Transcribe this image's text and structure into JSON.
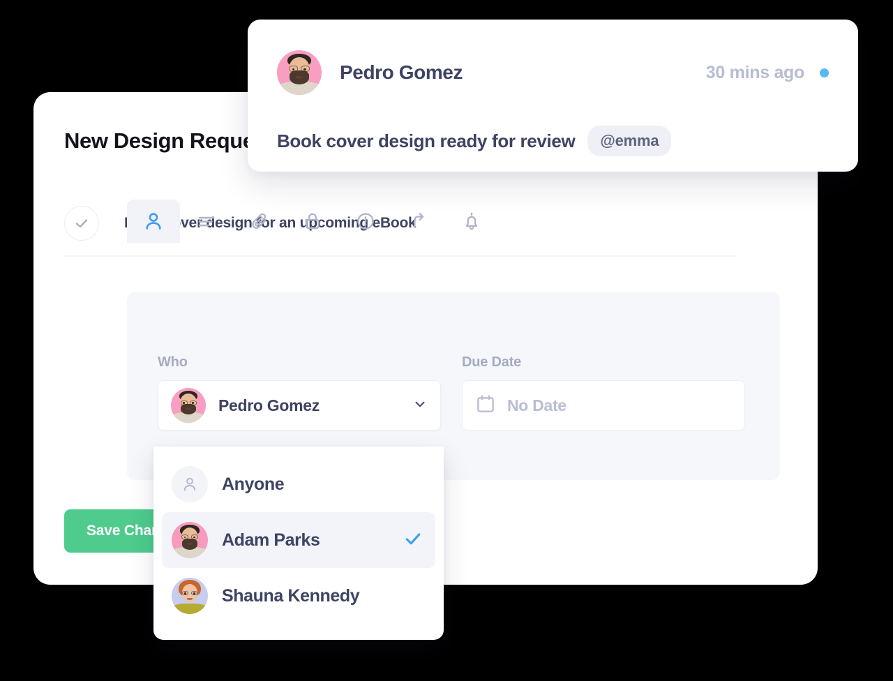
{
  "main_card": {
    "title": "New Design Request",
    "task": {
      "label": "Book cover design for an upcoming eBook",
      "status_icon": "check-circle-icon",
      "completed": false
    },
    "tabs": [
      {
        "id": "who",
        "icon": "person-icon",
        "active": true
      },
      {
        "id": "description",
        "icon": "lines-icon",
        "active": false
      },
      {
        "id": "attachments",
        "icon": "paperclip-icon",
        "active": false
      },
      {
        "id": "privacy",
        "icon": "lock-icon",
        "active": false
      },
      {
        "id": "priority",
        "icon": "exclamation-circle-icon",
        "active": false
      },
      {
        "id": "escalate",
        "icon": "arrow-up-icon",
        "active": false
      },
      {
        "id": "reminders",
        "icon": "bell-icon",
        "active": false
      }
    ],
    "fields": {
      "who": {
        "label": "Who",
        "value": "Pedro Gomez",
        "avatar_bg": "#f99ec0",
        "chevron_icon": "chevron-down-icon"
      },
      "due_date": {
        "label": "Due Date",
        "value": "",
        "placeholder": "No Date",
        "icon": "calendar-icon"
      }
    },
    "save_button": "Save Changes"
  },
  "dropdown": {
    "options": [
      {
        "label": "Anyone",
        "icon": "person-outline-icon",
        "avatar_bg": "#f3f4f8",
        "selected": false
      },
      {
        "label": "Adam Parks",
        "icon": "avatar",
        "avatar_bg": "#f79bbd",
        "selected": true
      },
      {
        "label": "Shauna Kennedy",
        "icon": "avatar",
        "avatar_bg": "#c6cdf0",
        "selected": false
      }
    ],
    "check_icon": "check-icon"
  },
  "notification": {
    "author": "Pedro Gomez",
    "avatar_bg": "#f99ec0",
    "timestamp": "30 mins ago",
    "unread": true,
    "message": "Book cover design ready for review",
    "mention": "@emma"
  },
  "colors": {
    "accent_green": "#4ecb8d",
    "accent_blue": "#3f9df2",
    "unread_dot": "#56b9f5",
    "text_dark": "#3e4362",
    "text_title": "#12141c",
    "text_muted": "#a6abc2",
    "panel_bg": "#f6f7fa",
    "page_bg": "#000000"
  }
}
